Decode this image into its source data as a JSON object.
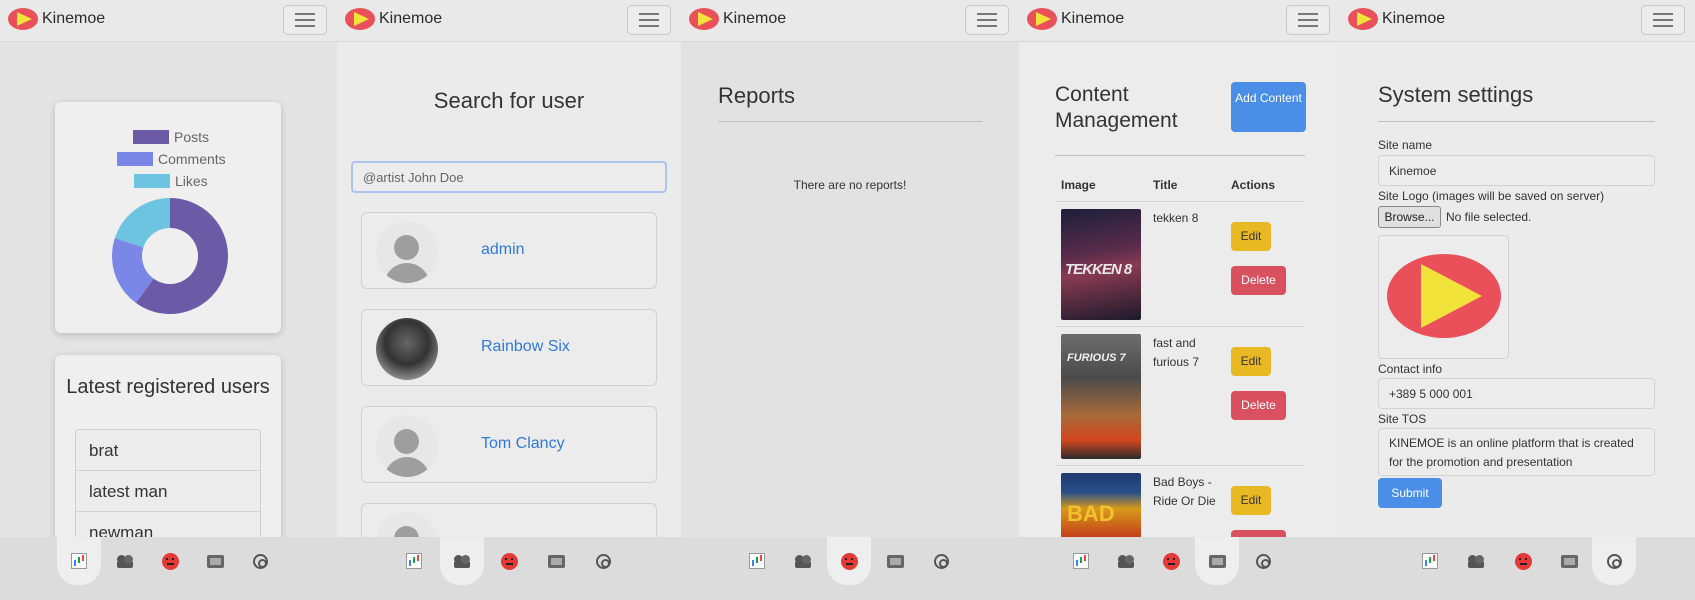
{
  "app": {
    "brand": "Kinemoe",
    "logo_colors": {
      "ellipse": "#e9505a",
      "triangle": "#f2e33a"
    }
  },
  "bottom_nav": {
    "items": [
      {
        "icon": "chart-icon",
        "label": "Statistics"
      },
      {
        "icon": "users-icon",
        "label": "Users"
      },
      {
        "icon": "angry-face-icon",
        "label": "Reports"
      },
      {
        "icon": "film-icon",
        "label": "Content"
      },
      {
        "icon": "gear-icon",
        "label": "Settings"
      }
    ]
  },
  "dashboard": {
    "chart_data": {
      "type": "doughnut",
      "legend": [
        "Posts",
        "Comments",
        "Likes"
      ],
      "colors": [
        "#6b5ba7",
        "#7b87e6",
        "#6cc4e0"
      ],
      "values": [
        60,
        20,
        20
      ],
      "legend_position": "top"
    },
    "latest_users_title": "Latest registered users",
    "latest_users": [
      "brat",
      "latest man",
      "newman"
    ]
  },
  "search": {
    "title": "Search for user",
    "placeholder": "@artist John Doe",
    "results": [
      "admin",
      "Rainbow Six",
      "Tom Clancy",
      ""
    ]
  },
  "reports": {
    "title": "Reports",
    "empty_message": "There are no reports!"
  },
  "content": {
    "title": "Content Management",
    "add_button": "Add Content",
    "columns": [
      "Image",
      "Title",
      "Actions"
    ],
    "rows": [
      {
        "title": "tekken 8",
        "poster_text": "TEKKEN 8"
      },
      {
        "title": "fast and furious 7",
        "poster_text": "FURIOUS 7"
      },
      {
        "title": "Bad Boys - Ride Or Die",
        "poster_text": "BAD"
      }
    ],
    "edit_label": "Edit",
    "delete_label": "Delete"
  },
  "settings": {
    "title": "System settings",
    "site_name_label": "Site name",
    "site_name_value": "Kinemoe",
    "site_logo_label": "Site Logo (images will be saved on server)",
    "browse_label": "Browse...",
    "no_file_label": "No file selected.",
    "contact_label": "Contact info",
    "contact_value": "+389 5 000 001",
    "tos_label": "Site TOS",
    "tos_value": "KINEMOE is an online platform that is created for the promotion and presentation",
    "submit_label": "Submit"
  }
}
